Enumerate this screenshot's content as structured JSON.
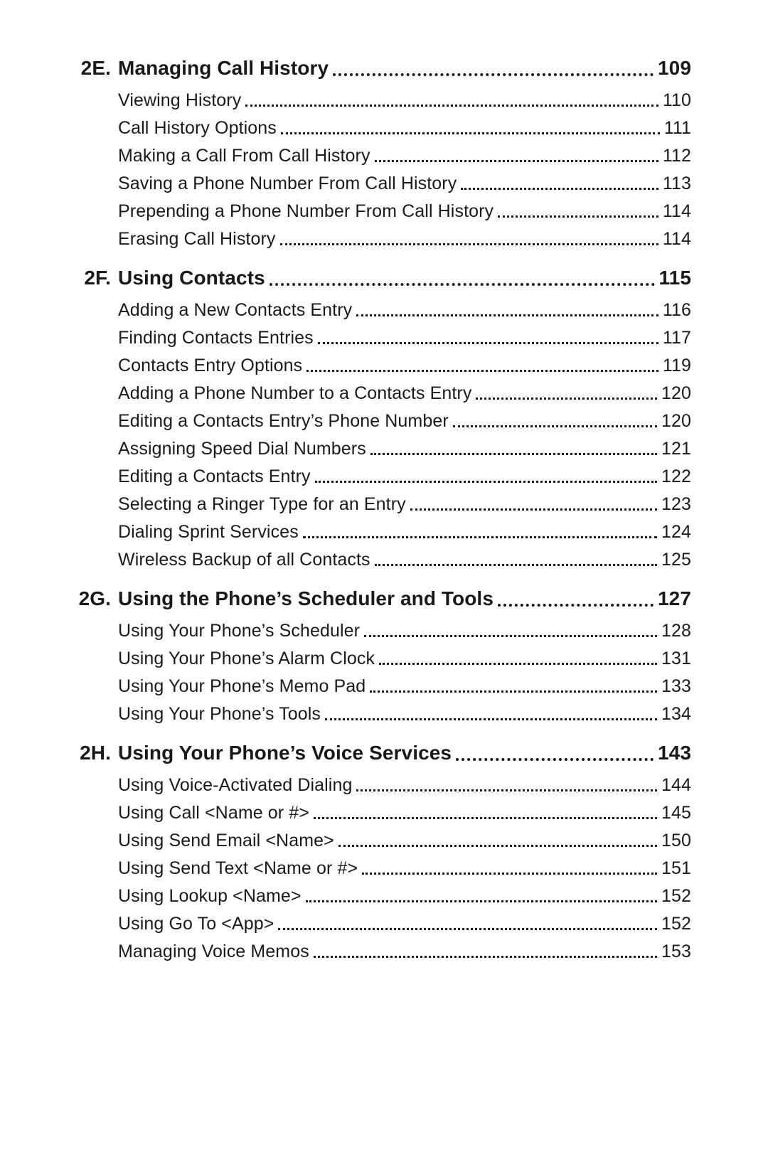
{
  "toc": {
    "sections": [
      {
        "id": "2E.",
        "title": "Managing Call History",
        "page": "109",
        "items": [
          {
            "title": "Viewing History",
            "page": "110"
          },
          {
            "title": "Call History Options",
            "page": "111"
          },
          {
            "title": "Making a Call From Call History",
            "page": "112"
          },
          {
            "title": "Saving a Phone Number From Call History",
            "page": "113"
          },
          {
            "title": "Prepending a Phone Number From Call History",
            "page": "114"
          },
          {
            "title": "Erasing Call History",
            "page": "114"
          }
        ]
      },
      {
        "id": "2F.",
        "title": "Using Contacts",
        "page": "115",
        "items": [
          {
            "title": "Adding a New Contacts Entry",
            "page": "116"
          },
          {
            "title": "Finding Contacts Entries",
            "page": "117"
          },
          {
            "title": "Contacts Entry Options",
            "page": "119"
          },
          {
            "title": "Adding a Phone Number to a Contacts Entry",
            "page": "120"
          },
          {
            "title": "Editing a Contacts Entry’s Phone Number",
            "page": "120"
          },
          {
            "title": "Assigning Speed Dial Numbers",
            "page": "121"
          },
          {
            "title": "Editing a Contacts Entry",
            "page": "122"
          },
          {
            "title": "Selecting a Ringer Type for an Entry",
            "page": "123"
          },
          {
            "title": "Dialing Sprint Services",
            "page": "124"
          },
          {
            "title": "Wireless Backup of all Contacts",
            "page": "125"
          }
        ]
      },
      {
        "id": "2G.",
        "title": "Using the Phone’s Scheduler and Tools",
        "page": "127",
        "items": [
          {
            "title": "Using Your Phone’s Scheduler",
            "page": "128"
          },
          {
            "title": "Using Your Phone’s Alarm Clock",
            "page": "131"
          },
          {
            "title": "Using Your Phone’s Memo Pad",
            "page": "133"
          },
          {
            "title": "Using Your Phone’s Tools",
            "page": "134"
          }
        ]
      },
      {
        "id": "2H.",
        "title": "Using Your Phone’s Voice Services",
        "page": "143",
        "items": [
          {
            "title": "Using Voice-Activated Dialing",
            "page": "144"
          },
          {
            "title": "Using Call <Name or #>",
            "page": "145"
          },
          {
            "title": "Using Send Email <Name>",
            "page": "150"
          },
          {
            "title": "Using Send Text <Name or #>",
            "page": "151"
          },
          {
            "title": "Using Lookup <Name>",
            "page": "152"
          },
          {
            "title": "Using Go To <App>",
            "page": "152"
          },
          {
            "title": "Managing Voice Memos",
            "page": "153"
          }
        ]
      }
    ]
  }
}
